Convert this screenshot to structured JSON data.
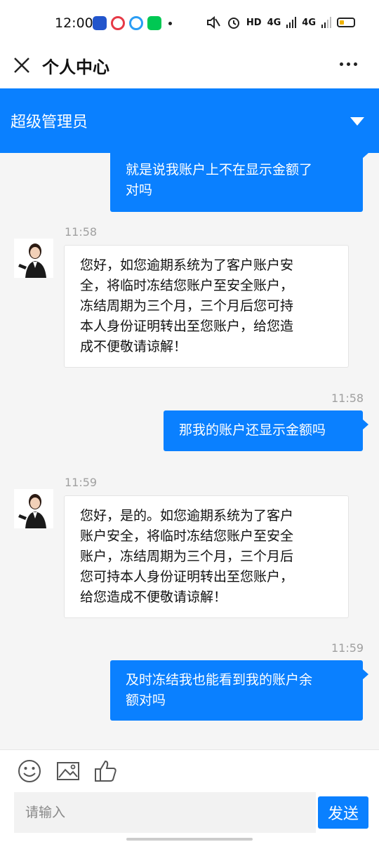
{
  "status": {
    "time": "12:00",
    "network_text": "HD",
    "signal1": "4G",
    "signal2": "4G"
  },
  "title_bar": {
    "title": "个人中心",
    "close_icon": "close-icon",
    "more_icon": "more-icon"
  },
  "header": {
    "agent_name": "超级管理员",
    "dropdown_icon": "chevron-down-icon",
    "accent_color": "#0a80ff"
  },
  "messages": [
    {
      "from": "me",
      "text_lines": [
        "就是说我账户上不在显示金额了",
        "对吗"
      ]
    },
    {
      "from": "agent",
      "time": "11:58",
      "text_lines": [
        "您好，如您逾期系统为了客户账户安",
        "全，将临时冻结您账户至安全账户，",
        "冻结周期为三个月，三个月后您可持",
        "本人身份证明转出至您账户，给您造",
        "成不便敬请谅解！"
      ]
    },
    {
      "from": "me",
      "time": "11:58",
      "text_lines": [
        "那我的账户还显示金额吗"
      ]
    },
    {
      "from": "agent",
      "time": "11:59",
      "text_lines": [
        "您好，是的。如您逾期系统为了客户",
        "账户安全，将临时冻结您账户至安全",
        "账户，冻结周期为三个月，三个月后",
        "您可持本人身份证明转出至您账户，",
        "给您造成不便敬请谅解！"
      ]
    },
    {
      "from": "me",
      "time": "11:59",
      "text_lines": [
        "及时冻结我也能看到我的账户余",
        "额对吗"
      ]
    }
  ],
  "toolbar": {
    "emoji_icon": "emoji-icon",
    "image_icon": "image-icon",
    "like_icon": "thumbs-up-icon",
    "input_placeholder": "请输入",
    "send_label": "发送"
  }
}
